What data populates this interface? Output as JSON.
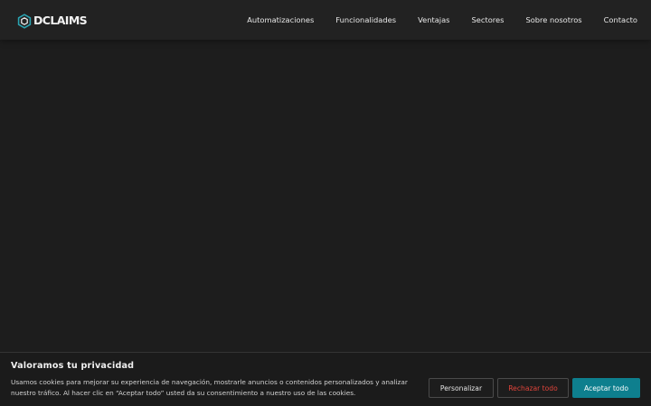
{
  "header": {
    "logo_text": "DCLAIMS",
    "nav": [
      {
        "label": "Automatizaciones"
      },
      {
        "label": "Funcionalidades"
      },
      {
        "label": "Ventajas"
      },
      {
        "label": "Sectores"
      },
      {
        "label": "Sobre nosotros"
      },
      {
        "label": "Contacto"
      }
    ]
  },
  "cookie_banner": {
    "title": "Valoramos tu privacidad",
    "text": "Usamos cookies para mejorar su experiencia de navegación, mostrarle anuncios o contenidos personalizados y analizar nuestro tráfico. Al hacer clic en “Aceptar todo” usted da su consentimiento a nuestro uso de las cookies.",
    "buttons": {
      "customize": "Personalizar",
      "reject": "Rechazar todo",
      "accept": "Aceptar todo"
    }
  },
  "colors": {
    "background": "#1d1d1d",
    "header": "#222222",
    "accent": "#0e7f8e",
    "reject_text": "#e0443b",
    "logo_mark": "#2aa3b1"
  },
  "icons": {
    "logo": "dclaims-hexagon-logo-icon"
  }
}
